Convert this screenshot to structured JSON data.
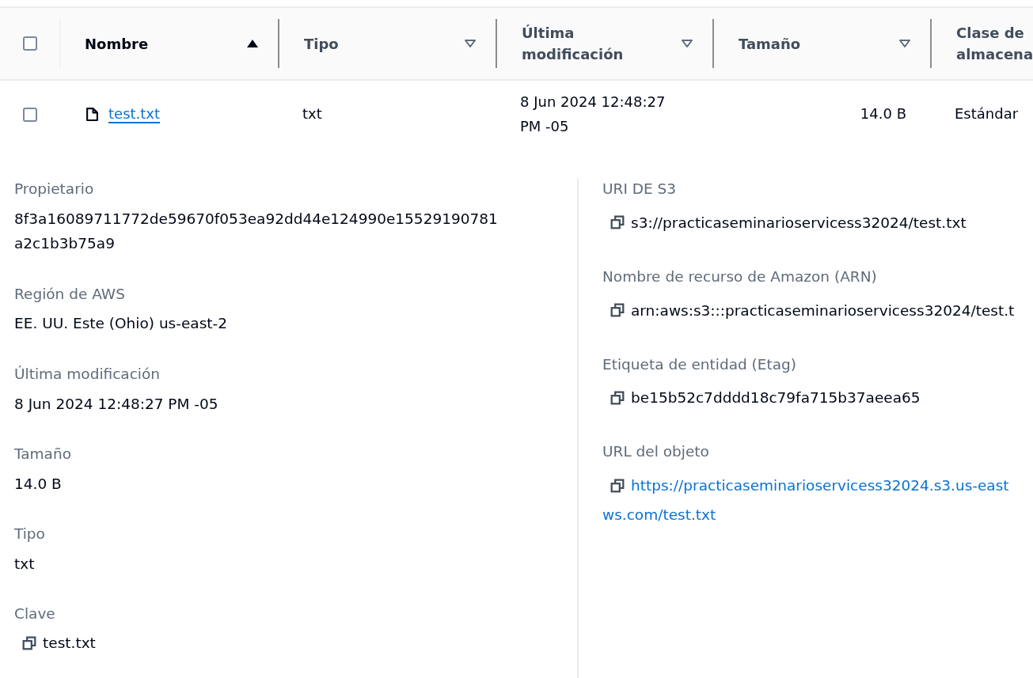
{
  "table": {
    "select_all": {
      "checked": false
    },
    "columns": [
      {
        "label": "Nombre",
        "sorted": true
      },
      {
        "label": "Tipo",
        "sorted": false
      },
      {
        "label": "Última modificación",
        "sorted": false
      },
      {
        "label": "Tamaño",
        "sorted": false
      },
      {
        "label": "Clase de almacena"
      }
    ],
    "rows": [
      {
        "checked": false,
        "name": "test.txt",
        "type": "txt",
        "modified": "8 Jun 2024 12:48:27 PM -05",
        "size": "14.0 B",
        "storage_class": "Estándar"
      }
    ]
  },
  "details": {
    "left": [
      {
        "kind": "text",
        "label": "Propietario",
        "value": "8f3a16089711772de59670f053ea92dd44e124990e15529190781a2c1b3b75a9"
      },
      {
        "kind": "text",
        "label": "Región de AWS",
        "value": "EE. UU. Este (Ohio) us-east-2"
      },
      {
        "kind": "text",
        "label": "Última modificación",
        "value": "8 Jun 2024 12:48:27 PM -05"
      },
      {
        "kind": "text",
        "label": "Tamaño",
        "value": "14.0 B"
      },
      {
        "kind": "text",
        "label": "Tipo",
        "value": "txt"
      },
      {
        "kind": "copy",
        "label": "Clave",
        "value": "test.txt"
      }
    ],
    "right": [
      {
        "kind": "copy",
        "label": "URI DE S3",
        "value": "s3://practicaseminarioservicess32024/test.txt"
      },
      {
        "kind": "copy",
        "label": "Nombre de recurso de Amazon (ARN)",
        "value": "arn:aws:s3:::practicaseminarioservicess32024/test.t"
      },
      {
        "kind": "copy",
        "label": "Etiqueta de entidad (Etag)",
        "value": "be15b52c7dddd18c79fa715b37aeea65"
      },
      {
        "kind": "copy-link",
        "label": "URL del objeto",
        "lines": [
          "https://practicaseminarioservicess32024.s3.us-east",
          "ws.com/test.txt"
        ]
      }
    ]
  }
}
